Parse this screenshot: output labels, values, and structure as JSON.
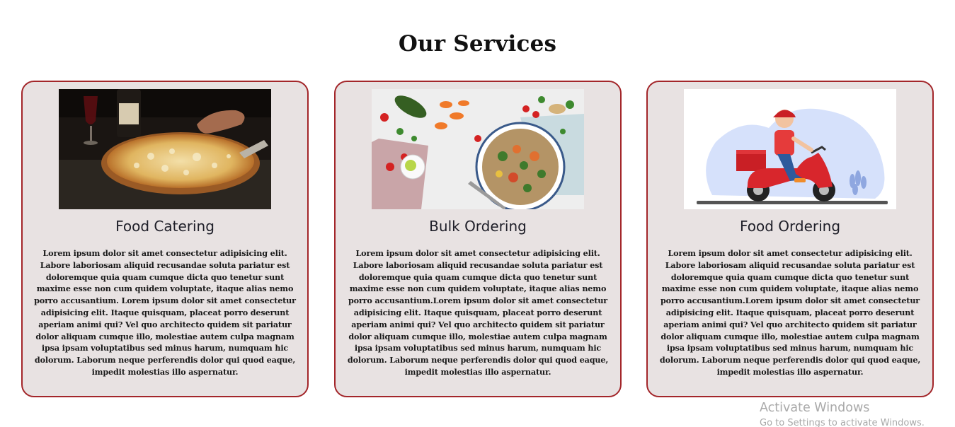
{
  "section": {
    "title": "Our Services"
  },
  "cards": [
    {
      "title": "Food Catering",
      "image": "pizza-photo",
      "text": "Lorem ipsum dolor sit amet consectetur adipisicing elit. Labore laboriosam aliquid recusandae soluta pariatur est doloremque quia quam cumque dicta quo tenetur sunt maxime esse non cum quidem voluptate, itaque alias nemo porro accusantium. Lorem ipsum dolor sit amet consectetur adipisicing elit. Itaque quisquam, placeat porro deserunt aperiam animi qui? Vel quo architecto quidem sit pariatur dolor aliquam cumque illo, molestiae autem culpa magnam ipsa ipsam voluptatibus sed minus harum, numquam hic dolorum. Laborum neque perferendis dolor qui quod eaque, impedit molestias illo aspernatur."
    },
    {
      "title": "Bulk Ordering",
      "image": "salad-bowl-photo",
      "text": "Lorem ipsum dolor sit amet consectetur adipisicing elit. Labore laboriosam aliquid recusandae soluta pariatur est doloremque quia quam cumque dicta quo tenetur sunt maxime esse non cum quidem voluptate, itaque alias nemo porro accusantium.Lorem ipsum dolor sit amet consectetur adipisicing elit. Itaque quisquam, placeat porro deserunt aperiam animi qui? Vel quo architecto quidem sit pariatur dolor aliquam cumque illo, molestiae autem culpa magnam ipsa ipsam voluptatibus sed minus harum, numquam hic dolorum. Laborum neque perferendis dolor qui quod eaque, impedit molestias illo aspernatur."
    },
    {
      "title": "Food Ordering",
      "image": "delivery-scooter-illustration",
      "text": "Lorem ipsum dolor sit amet consectetur adipisicing elit. Labore laboriosam aliquid recusandae soluta pariatur est doloremque quia quam cumque dicta quo tenetur sunt maxime esse non cum quidem voluptate, itaque alias nemo porro accusantium.Lorem ipsum dolor sit amet consectetur adipisicing elit. Itaque quisquam, placeat porro deserunt aperiam animi qui? Vel quo architecto quidem sit pariatur dolor aliquam cumque illo, molestiae autem culpa magnam ipsa ipsam voluptatibus sed minus harum, numquam hic dolorum. Laborum neque perferendis dolor qui quod eaque, impedit molestias illo aspernatur."
    }
  ],
  "watermark": {
    "line1": "Activate Windows",
    "line2": "Go to Settings to activate Windows."
  },
  "colors": {
    "card_background": "#e8e2e2",
    "card_border": "#a3262a"
  }
}
